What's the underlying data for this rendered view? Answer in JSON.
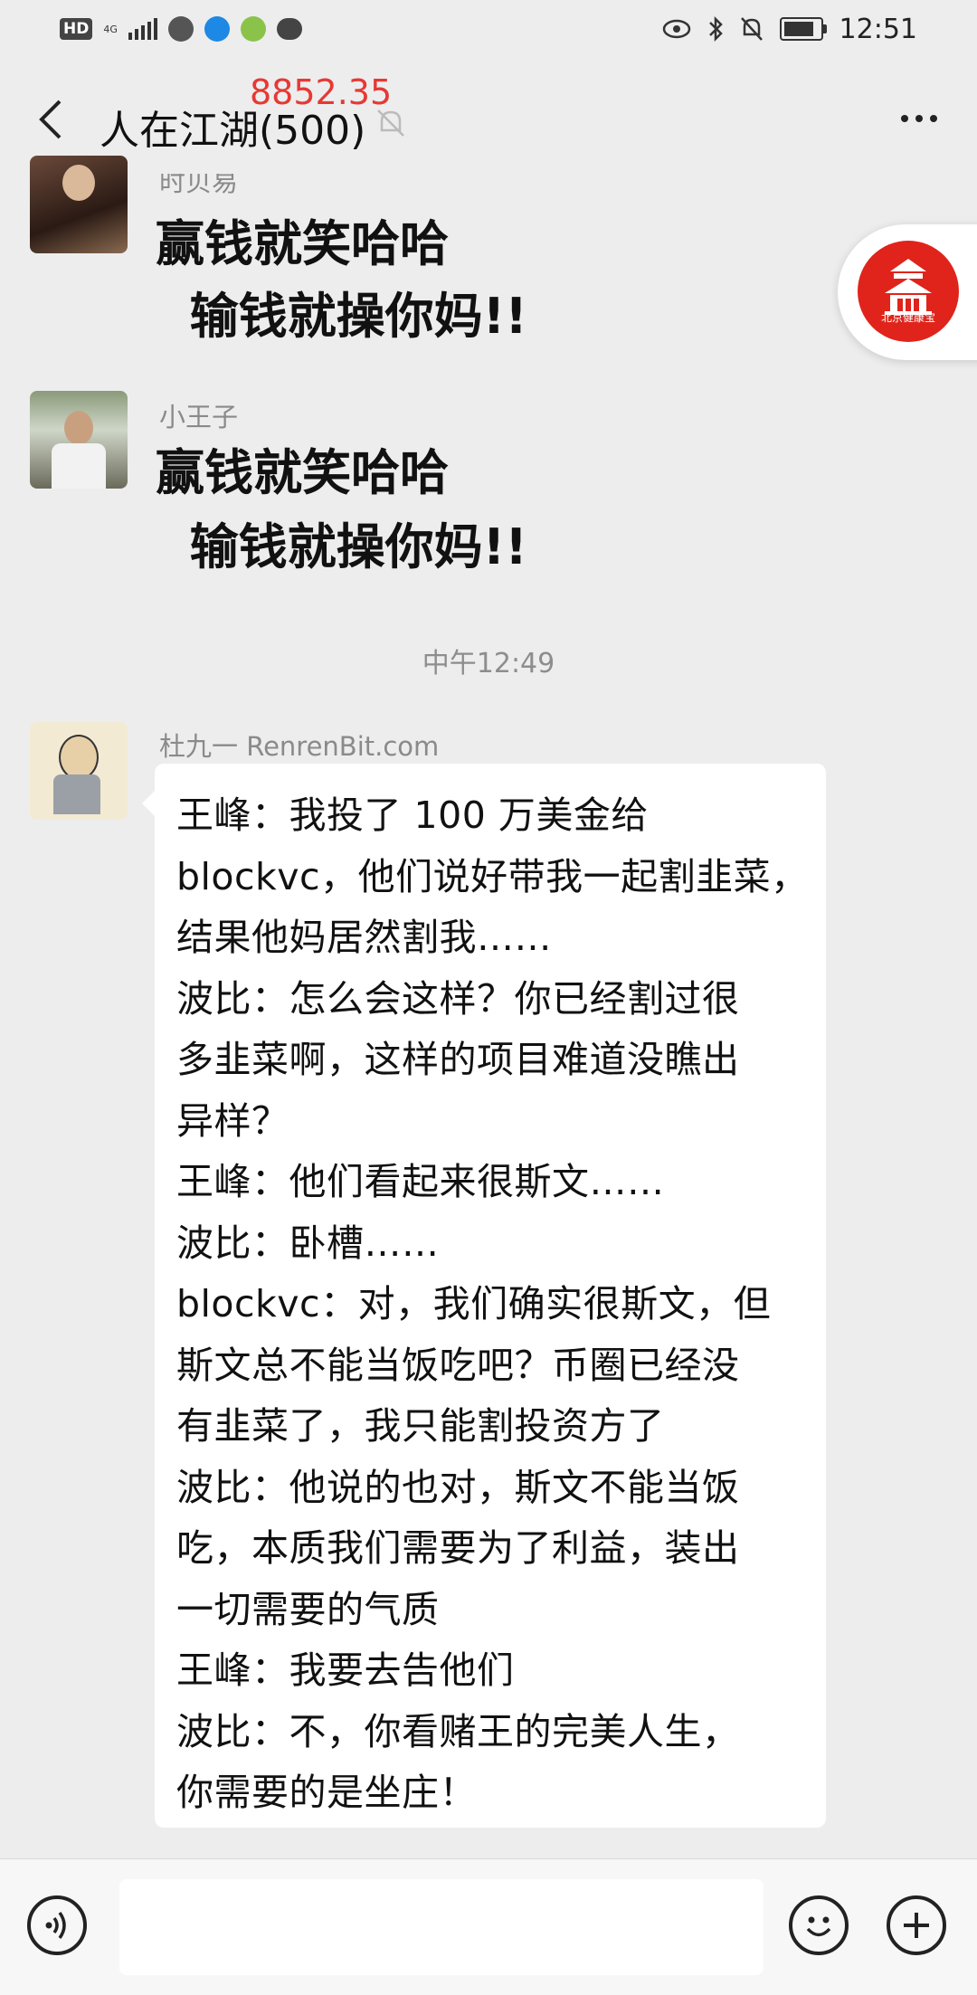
{
  "status_bar": {
    "hd": "HD",
    "network": "4G",
    "time": "12:51",
    "battery_fraction": 0.85
  },
  "nav": {
    "title": "人在江湖(500)",
    "overlay_number": "8852.35"
  },
  "messages": [
    {
      "sender": "时贝易",
      "text_lines": [
        "赢钱就笑哈哈",
        "  输钱就操你妈!!"
      ]
    },
    {
      "sender": "小王子",
      "text_lines": [
        "赢钱就笑哈哈",
        "  输钱就操你妈!!"
      ]
    }
  ],
  "timestamp": "中午12:49",
  "long_message": {
    "sender": "杜九一 RenrenBit.com",
    "lines": [
      "王峰：我投了 100 万美金给",
      "blockvc，他们说好带我一起割韭菜，",
      "结果他妈居然割我……",
      "波比：怎么会这样？你已经割过很",
      "多韭菜啊，这样的项目难道没瞧出",
      "异样？",
      "王峰：他们看起来很斯文……",
      "波比：卧槽……",
      "blockvc：对，我们确实很斯文，但",
      "斯文总不能当饭吃吧？币圈已经没",
      "有韭菜了，我只能割投资方了",
      "波比：他说的也对，斯文不能当饭",
      "吃，本质我们需要为了利益，装出",
      "一切需要的气质",
      "王峰：我要去告他们",
      "波比：不，你看赌王的完美人生，",
      "你需要的是坐庄！"
    ]
  },
  "floating_badge": {
    "label": "北京健康宝",
    "color": "#e0241b"
  },
  "input": {
    "placeholder": ""
  }
}
